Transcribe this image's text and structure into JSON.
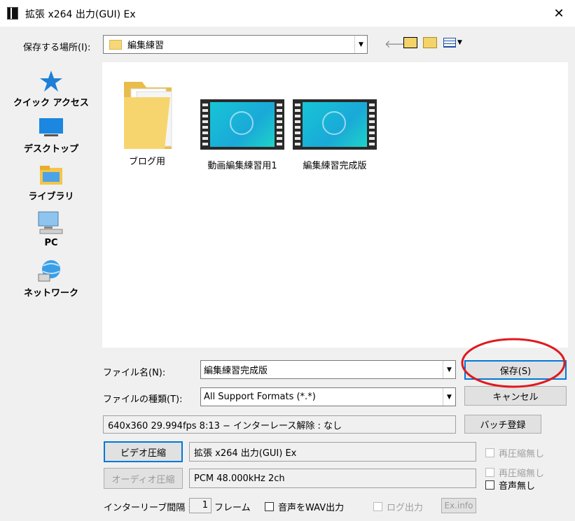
{
  "window": {
    "title": "拡張 x264 出力(GUI) Ex",
    "close": "✕"
  },
  "location": {
    "label": "保存する場所(I):",
    "value": "編集練習"
  },
  "places": [
    {
      "label": "クイック アクセス",
      "icon": "star-icon"
    },
    {
      "label": "デスクトップ",
      "icon": "desktop-icon"
    },
    {
      "label": "ライブラリ",
      "icon": "library-icon"
    },
    {
      "label": "PC",
      "icon": "pc-icon"
    },
    {
      "label": "ネットワーク",
      "icon": "network-icon"
    }
  ],
  "files": [
    {
      "name": "ブログ用",
      "type": "folder"
    },
    {
      "name": "動画編集練習用1",
      "type": "video"
    },
    {
      "name": "編集練習完成版",
      "type": "video"
    }
  ],
  "form": {
    "filename_label": "ファイル名(N):",
    "filename_value": "編集練習完成版",
    "filetype_label": "ファイルの種類(T):",
    "filetype_value": "All Support Formats (*.*)",
    "save": "保存(S)",
    "cancel": "キャンセル",
    "info_text": "640x360  29.994fps  8:13  −  インターレース解除 : なし",
    "batch": "バッチ登録",
    "video_btn": "ビデオ圧縮",
    "video_codec": "拡張 x264 出力(GUI) Ex",
    "recompress1": "再圧縮無し",
    "audio_btn": "オーディオ圧縮",
    "audio_codec": "PCM 48.000kHz 2ch",
    "recompress2": "再圧縮無し",
    "no_audio": "音声無し",
    "interleave_label": "インターリーブ間隔 :",
    "interleave_value": "1",
    "interleave_unit": "フレーム",
    "wav_out": "音声をWAV出力",
    "log_out": "ログ出力",
    "exinfo": "Ex.info"
  },
  "colors": {
    "highlight_circle": "#e0191f",
    "accent": "#0078d7"
  }
}
